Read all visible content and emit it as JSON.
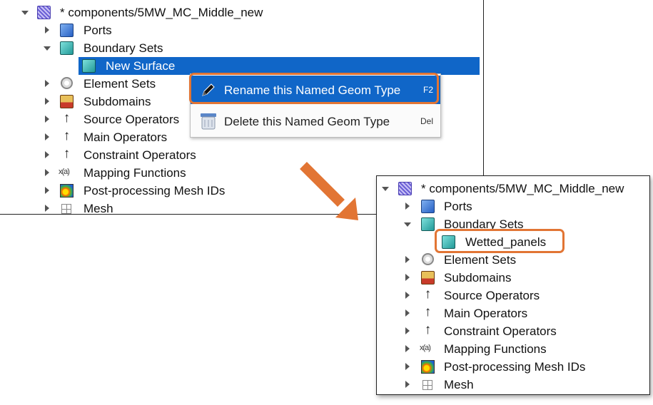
{
  "colors": {
    "accent": "#1066c8",
    "highlight": "#e27534"
  },
  "tree_before": {
    "root": "* components/5MW_MC_Middle_new",
    "items": [
      {
        "label": "Ports",
        "icon": "cube-blue-icon"
      },
      {
        "label": "Boundary Sets",
        "icon": "cube-teal-icon"
      },
      {
        "label": "New Surface",
        "icon": "cube-teal-icon"
      },
      {
        "label": "Element Sets",
        "icon": "hexagon-icon"
      },
      {
        "label": "Subdomains",
        "icon": "subdomain-icon"
      },
      {
        "label": "Source Operators",
        "icon": "operator-arrow-icon"
      },
      {
        "label": "Main Operators",
        "icon": "operator-arrow-icon"
      },
      {
        "label": "Constraint Operators",
        "icon": "operator-arrow-icon"
      },
      {
        "label": "Mapping Functions",
        "icon": "mapping-function-icon"
      },
      {
        "label": "Post-processing Mesh IDs",
        "icon": "post-processing-icon"
      },
      {
        "label": "Mesh",
        "icon": "mesh-grid-icon"
      }
    ]
  },
  "context_menu": {
    "items": [
      {
        "label": "Rename this Named Geom Type",
        "shortcut": "F2",
        "icon": "pencil-icon"
      },
      {
        "label": "Delete this Named Geom Type",
        "shortcut": "Del",
        "icon": "delete-icon"
      }
    ]
  },
  "tree_after": {
    "root": "* components/5MW_MC_Middle_new",
    "items": [
      {
        "label": "Ports"
      },
      {
        "label": "Boundary Sets"
      },
      {
        "label": "Wetted_panels"
      },
      {
        "label": "Element Sets"
      },
      {
        "label": "Subdomains"
      },
      {
        "label": "Source Operators"
      },
      {
        "label": "Main Operators"
      },
      {
        "label": "Constraint Operators"
      },
      {
        "label": "Mapping Functions"
      },
      {
        "label": "Post-processing Mesh IDs"
      },
      {
        "label": "Mesh"
      }
    ]
  },
  "mapping_icon_text": "x(a)"
}
